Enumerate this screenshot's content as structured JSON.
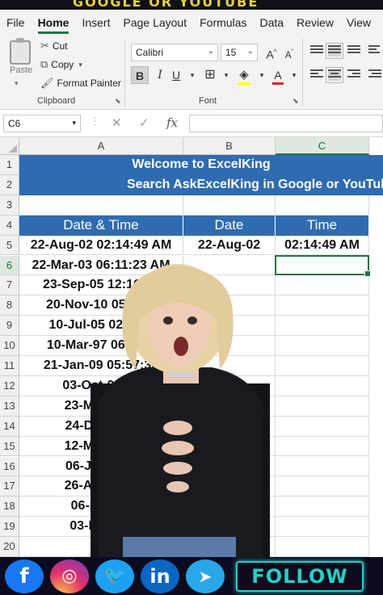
{
  "banner": {
    "text": "GOOGLE OR YOUTUBE"
  },
  "ribbon_tabs": [
    "File",
    "Home",
    "Insert",
    "Page Layout",
    "Formulas",
    "Data",
    "Review",
    "View"
  ],
  "active_tab": "Home",
  "clipboard": {
    "paste_label": "Paste",
    "cut_label": "Cut",
    "copy_label": "Copy",
    "format_painter_label": "Format Painter",
    "group_label": "Clipboard"
  },
  "font": {
    "name": "Calibri",
    "size": "15",
    "group_label": "Font",
    "bold": "B",
    "italic": "I",
    "underline": "U",
    "grow": "A",
    "shrink": "A",
    "font_color": "A"
  },
  "formula_bar": {
    "name_box": "C6",
    "cancel": "✕",
    "enter": "✓",
    "fx": "fx",
    "value": ""
  },
  "grid": {
    "columns": [
      "A",
      "B",
      "C"
    ],
    "selected_column": "C",
    "rows": [
      "1",
      "2",
      "3",
      "4",
      "5",
      "6",
      "7",
      "8",
      "9",
      "10",
      "11",
      "12",
      "13",
      "14",
      "15",
      "16",
      "17",
      "18",
      "19",
      "20"
    ],
    "selected_row": "6",
    "title_line1": "Welcome to ExcelKing",
    "title_line2": "Search AskExcelKing in Google or YouTube",
    "headers": [
      "Date & Time",
      "Date",
      "Time"
    ],
    "data": [
      {
        "datetime": "22-Aug-02 02:14:49 AM",
        "date": "22-Aug-02",
        "time": "02:14:49 AM"
      },
      {
        "datetime": "22-Mar-03 06:11:23 AM",
        "date": "",
        "time": ""
      },
      {
        "datetime": "23-Sep-05 12:16:31",
        "date": "",
        "time": ""
      },
      {
        "datetime": "20-Nov-10 05:35:2",
        "date": "",
        "time": ""
      },
      {
        "datetime": "10-Jul-05 02:12:4",
        "date": "",
        "time": ""
      },
      {
        "datetime": "10-Mar-97 06:57:1",
        "date": "",
        "time": ""
      },
      {
        "datetime": "21-Jan-09 05:57:36",
        "date": "",
        "time": ""
      },
      {
        "datetime": "03-Oct-09 12",
        "date": "",
        "time": ""
      },
      {
        "datetime": "23-May-22 0",
        "date": "",
        "time": ""
      },
      {
        "datetime": "24-Dec-08 1",
        "date": "",
        "time": ""
      },
      {
        "datetime": "12-May-94 0",
        "date": "",
        "time": ""
      },
      {
        "datetime": "06-Jun-22 1",
        "date": "",
        "time": ""
      },
      {
        "datetime": "26-Aug-14 0",
        "date": "",
        "time": ""
      },
      {
        "datetime": "06-Feb-12",
        "date": "",
        "time": ""
      },
      {
        "datetime": "03-May-10",
        "date": "",
        "time": ""
      }
    ]
  },
  "social": {
    "facebook": "f",
    "instagram": "◎",
    "twitter": "🐦",
    "linkedin": "in",
    "telegram": "➤",
    "follow_label": "FOLLOW"
  },
  "colors": {
    "excel_green": "#217346",
    "header_blue": "#2f6bb0",
    "follow_cyan": "#23d0c4"
  }
}
